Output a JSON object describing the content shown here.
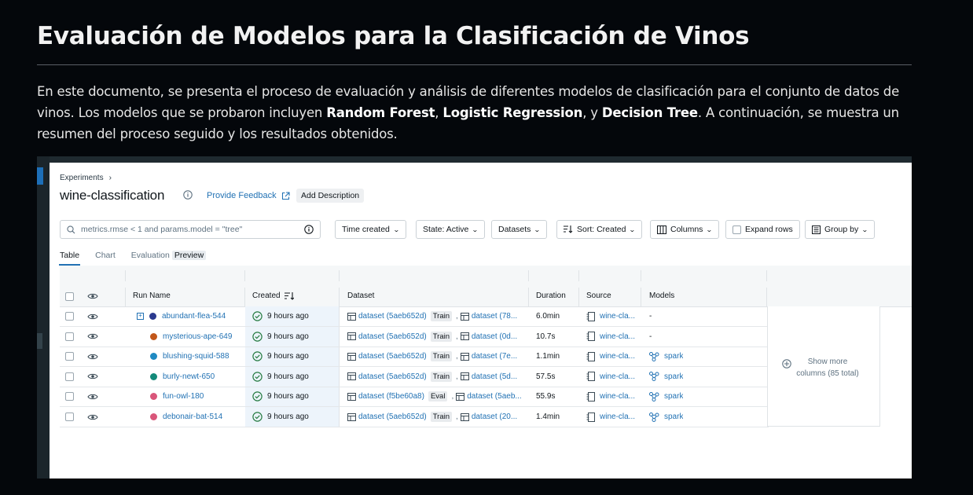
{
  "document": {
    "title": "Evaluación de Modelos para la Clasificación de Vinos",
    "intro_1": "En este documento, se presenta el proceso de evaluación y análisis de diferentes modelos de clasificación para el conjunto de datos de vinos. Los modelos que se probaron incluyen ",
    "model_1": "Random Forest",
    "sep_1": ", ",
    "model_2": "Logistic Regression",
    "sep_2": ", y ",
    "model_3": "Decision Tree",
    "intro_2": ". A continuación, se muestra un resumen del proceso seguido y los resultados obtenidos."
  },
  "ui": {
    "breadcrumb": "Experiments",
    "breadcrumb_sep": "›",
    "experiment_title": "wine-classification",
    "provide_feedback": "Provide Feedback",
    "add_description": "Add Description",
    "search_placeholder": "metrics.rmse < 1 and params.model = \"tree\"",
    "filters": {
      "time_created": "Time created",
      "state": "State: Active",
      "datasets": "Datasets",
      "sort": "Sort: Created",
      "columns": "Columns",
      "expand_rows": "Expand rows",
      "group_by": "Group by"
    },
    "tabs": {
      "table": "Table",
      "chart": "Chart",
      "evaluation": "Evaluation",
      "preview_badge": "Preview"
    },
    "columns": {
      "run_name": "Run Name",
      "created": "Created",
      "dataset": "Dataset",
      "duration": "Duration",
      "source": "Source",
      "models": "Models"
    },
    "show_more_1": "Show more",
    "show_more_2": "columns (85 total)",
    "rows": [
      {
        "name": "abundant-flea-544",
        "color": "#2b3a8f",
        "expand": "+",
        "created": "9 hours ago",
        "ds1": "dataset (5aeb652d)",
        "tag1": "Train",
        "ds2": "dataset (78...",
        "duration": "6.0min",
        "source": "wine-cla...",
        "models": "-"
      },
      {
        "name": "mysterious-ape-649",
        "color": "#c2571a",
        "expand": "",
        "created": "9 hours ago",
        "ds1": "dataset (5aeb652d)",
        "tag1": "Train",
        "ds2": "dataset (0d...",
        "duration": "10.7s",
        "source": "wine-cla...",
        "models": "-"
      },
      {
        "name": "blushing-squid-588",
        "color": "#1f8ac2",
        "expand": "",
        "created": "9 hours ago",
        "ds1": "dataset (5aeb652d)",
        "tag1": "Train",
        "ds2": "dataset (7e...",
        "duration": "1.1min",
        "source": "wine-cla...",
        "models": "spark"
      },
      {
        "name": "burly-newt-650",
        "color": "#148a7a",
        "expand": "",
        "created": "9 hours ago",
        "ds1": "dataset (5aeb652d)",
        "tag1": "Train",
        "ds2": "dataset (5d...",
        "duration": "57.5s",
        "source": "wine-cla...",
        "models": "spark"
      },
      {
        "name": "fun-owl-180",
        "color": "#d9567a",
        "expand": "",
        "created": "9 hours ago",
        "ds1": "dataset (f5be60a8)",
        "tag1": "Eval",
        "ds2": "dataset (5aeb...",
        "duration": "55.9s",
        "source": "wine-cla...",
        "models": "spark"
      },
      {
        "name": "debonair-bat-514",
        "color": "#d9567a",
        "expand": "",
        "created": "9 hours ago",
        "ds1": "dataset (5aeb652d)",
        "tag1": "Train",
        "ds2": "dataset (20...",
        "duration": "1.4min",
        "source": "wine-cla...",
        "models": "spark"
      }
    ]
  }
}
